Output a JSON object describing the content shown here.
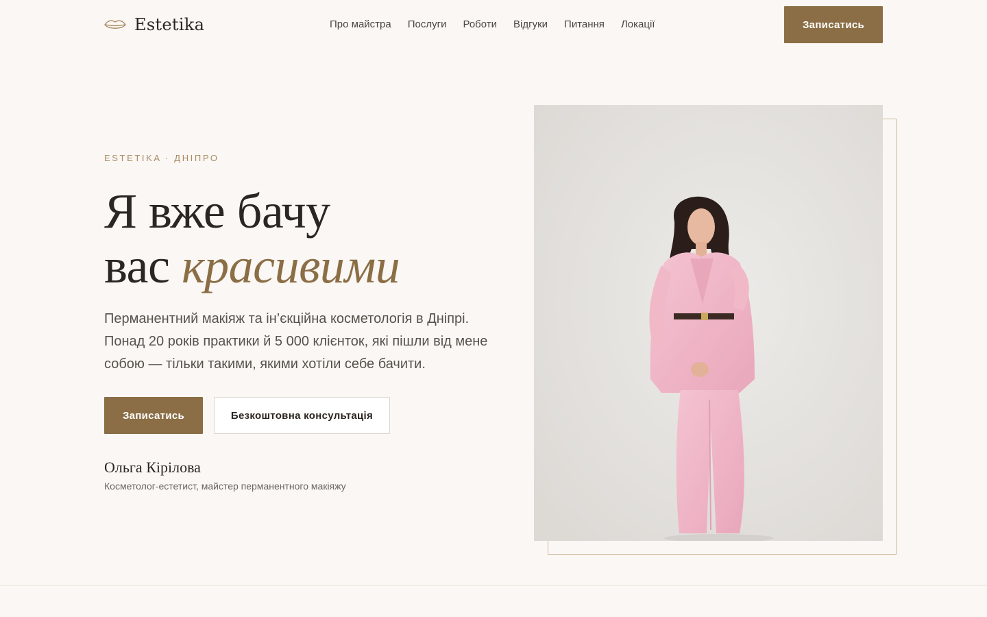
{
  "brand": {
    "name": "Estetika",
    "logo_icon": "lips-icon"
  },
  "nav": {
    "items": [
      {
        "label": "Про майстра"
      },
      {
        "label": "Послуги"
      },
      {
        "label": "Роботи"
      },
      {
        "label": "Відгуки"
      },
      {
        "label": "Питання"
      },
      {
        "label": "Локації"
      }
    ]
  },
  "header": {
    "cta_label": "Записатись"
  },
  "hero": {
    "eyebrow": "ESTETIKA · ДНІПРО",
    "headline_line1": "Я вже бачу",
    "headline_line2": "вас",
    "headline_accent": "красивими",
    "lead": "Перманентний макіяж та ін’єкційна косметологія в Дніпрі. Понад 20 років практики й 5 000 клієнток, які пішли від мене собою — тільки такими, якими хотіли себе бачити.",
    "primary_cta": "Записатись",
    "secondary_cta": "Безкоштовна консультація",
    "author_name": "Ольга Кірілова",
    "author_role": "Косметолог-естетист, майстер перманентного макіяжу"
  },
  "colors": {
    "accent": "#8b6e45",
    "background": "#faf7f4",
    "text": "#2a2622",
    "eyebrow": "#a88b63",
    "frame": "#cdb89a"
  }
}
